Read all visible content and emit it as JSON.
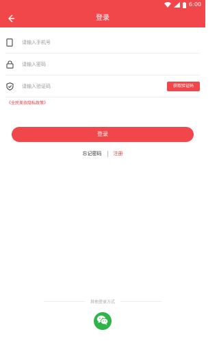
{
  "status_bar": {
    "time": "6:00",
    "icons": [
      "wifi-icon",
      "signal-icon",
      "battery-icon"
    ]
  },
  "app_bar": {
    "title": "登录",
    "back_icon": "back-arrow-icon"
  },
  "form": {
    "phone": {
      "placeholder": "请输入手机号",
      "value": "",
      "icon": "phone-icon"
    },
    "password": {
      "placeholder": "请输入密码",
      "value": "",
      "icon": "lock-icon"
    },
    "code": {
      "placeholder": "请输入验证码",
      "value": "",
      "icon": "shield-icon"
    },
    "get_code_label": "获取验证码"
  },
  "policy_link": "《全民美妆隐私政策》",
  "login_button": "登录",
  "links": {
    "forgot": "忘记密码",
    "register": "注册"
  },
  "other_login": {
    "label": "其他登录方式",
    "wechat_icon": "wechat-icon"
  },
  "colors": {
    "primary": "#f2474a",
    "link_red": "#e5393d",
    "wechat_green": "#2fb44a"
  }
}
